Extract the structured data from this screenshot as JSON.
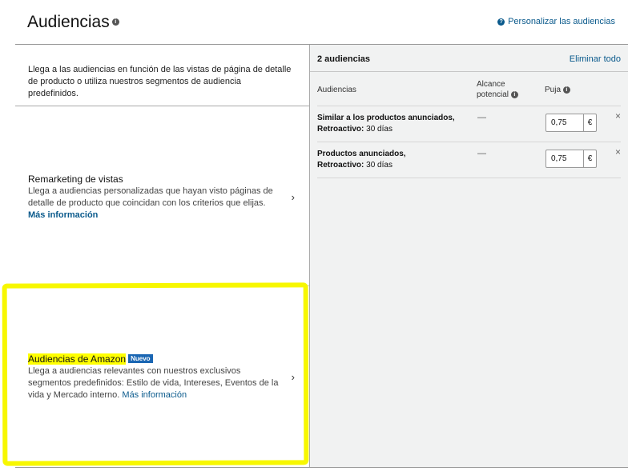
{
  "header": {
    "title": "Audiencias",
    "info_icon": "info-icon",
    "help_link": "Personalizar las audiencias",
    "help_icon": "help-icon"
  },
  "intro_text": "Llega a las audiencias en función de las vistas de página de detalle de producto o utiliza nuestros segmentos de audiencia predefinidos.",
  "options": [
    {
      "title": "Remarketing de vistas",
      "description": "Llega a audiencias personalizadas que hayan visto páginas de detalle de producto que coincidan con los criterios que elijas.",
      "link": "Más información"
    },
    {
      "title": "Audiencias de Amazon",
      "badge": "Nuevo",
      "description": "Llega a audiencias relevantes con nuestros exclusivos segmentos predefinidos: Estilo de vida, Intereses, Eventos de la vida y Mercado interno.",
      "link": "Más información"
    }
  ],
  "selected": {
    "count_label": "2 audiencias",
    "clear_all": "Eliminar todo",
    "columns": {
      "audiences": "Audiencias",
      "reach_line1": "Alcance",
      "reach_line2": "potencial",
      "bid": "Puja"
    },
    "rows": [
      {
        "name": "Similar a los productos anunciados,",
        "lookback_label": "Retroactivo:",
        "lookback_value": "30 días",
        "reach": "—",
        "bid": "0,75",
        "currency": "€",
        "remove": "×"
      },
      {
        "name": "Productos anunciados,",
        "lookback_label": "Retroactivo:",
        "lookback_value": "30 días",
        "reach": "—",
        "bid": "0,75",
        "currency": "€",
        "remove": "×"
      }
    ]
  },
  "chevron": "›",
  "colors": {
    "link": "#0a5a8c",
    "highlight": "#ffff00",
    "badge": "#1a66b3"
  }
}
